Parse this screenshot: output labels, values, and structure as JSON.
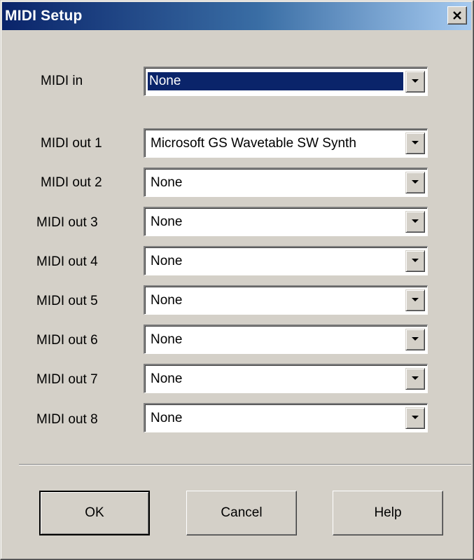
{
  "window": {
    "title": "MIDI Setup",
    "titlebar_colors": [
      "#0a246a",
      "#a6caf0"
    ],
    "close_icon": "close-icon"
  },
  "midi_in": {
    "label": "MIDI in",
    "value": "None",
    "selected": true
  },
  "midi_out": [
    {
      "label": "MIDI out 1",
      "value": "Microsoft GS Wavetable SW Synth"
    },
    {
      "label": "MIDI out 2",
      "value": "None"
    },
    {
      "label": "MIDI out 3",
      "value": "None"
    },
    {
      "label": "MIDI out 4",
      "value": "None"
    },
    {
      "label": "MIDI out 5",
      "value": "None"
    },
    {
      "label": "MIDI out 6",
      "value": "None"
    },
    {
      "label": "MIDI out 7",
      "value": "None"
    },
    {
      "label": "MIDI out 8",
      "value": "None"
    }
  ],
  "buttons": {
    "ok": "OK",
    "cancel": "Cancel",
    "help": "Help"
  }
}
